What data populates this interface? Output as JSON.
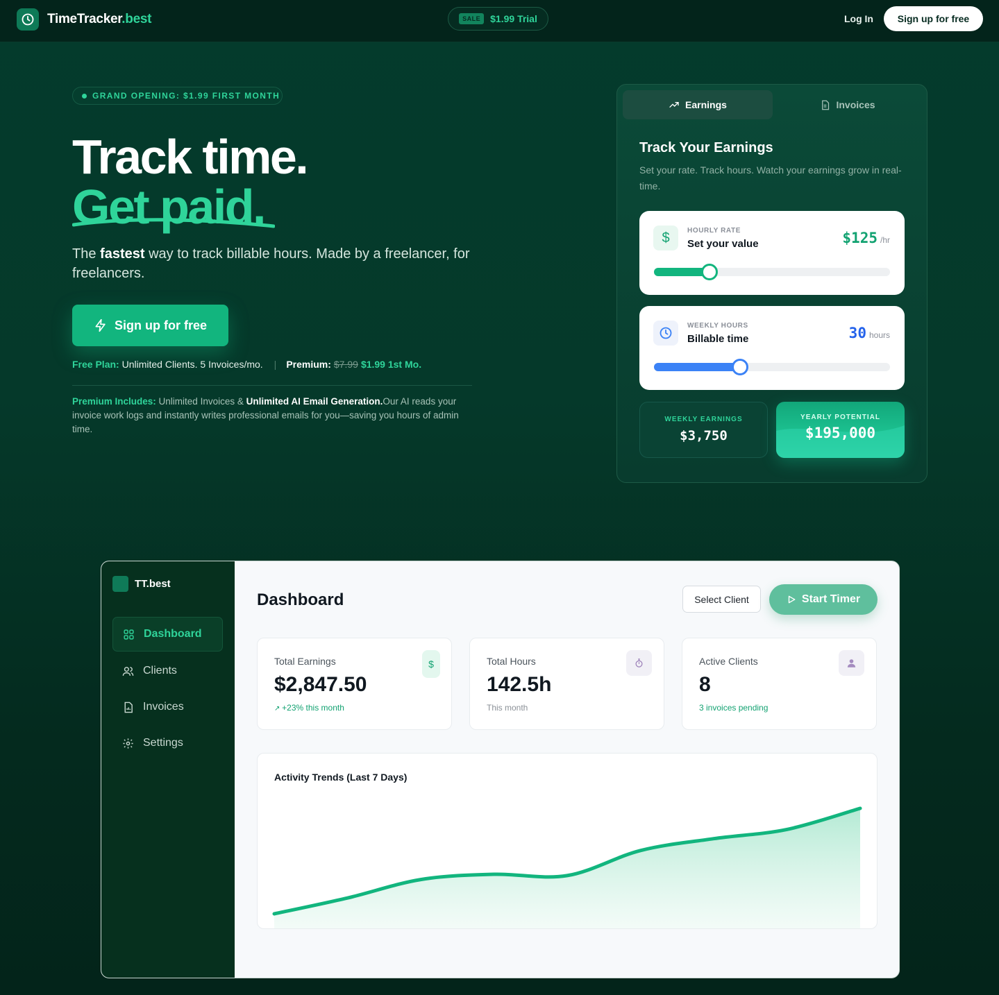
{
  "header": {
    "brand_name": "TimeTracker",
    "brand_tld": ".best",
    "sale_tag": "SALE",
    "trial_label": "$1.99 Trial",
    "login_label": "Log In",
    "signup_label": "Sign up for free"
  },
  "hero": {
    "badge": "GRAND OPENING: $1.99 FIRST MONTH",
    "headline_1": "Track time.",
    "headline_2": "Get paid.",
    "sub_pre": "The ",
    "sub_bold": "fastest",
    "sub_post": " way to track billable hours. Made by a freelancer, for freelancers.",
    "cta_label": "Sign up for free",
    "free_plan_label": "Free Plan:",
    "free_plan_text": " Unlimited Clients. 5 Invoices/mo.",
    "premium_label": "Premium:",
    "premium_old_price": "$7.99",
    "premium_new_price": "$1.99 1st Mo.",
    "includes_label": "Premium Includes:",
    "includes_text_1": " Unlimited Invoices & ",
    "includes_bold": "Unlimited AI Email Generation.",
    "includes_text_2": "Our AI reads your invoice work logs and instantly writes professional emails for you—saving you hours of admin time."
  },
  "calculator": {
    "tabs": [
      {
        "label": "Earnings",
        "icon": "trending-up-icon",
        "active": true
      },
      {
        "label": "Invoices",
        "icon": "document-icon",
        "active": false
      }
    ],
    "title": "Track Your Earnings",
    "subtitle": "Set your rate. Track hours. Watch your earnings grow in real-time.",
    "rate": {
      "label": "HOURLY RATE",
      "title": "Set your value",
      "value": "$125",
      "unit": "/hr",
      "slider_fraction": 0.235,
      "color": "#12b57e"
    },
    "hours": {
      "label": "WEEKLY HOURS",
      "title": "Billable time",
      "value": "30",
      "unit": "hours",
      "slider_fraction": 0.365,
      "color": "#3b82f6"
    },
    "weekly_label": "WEEKLY EARNINGS",
    "weekly_value": "$3,750",
    "yearly_label": "YEARLY POTENTIAL",
    "yearly_value": "$195,000"
  },
  "dashboard": {
    "brand": "TT.best",
    "nav": [
      {
        "label": "Dashboard",
        "icon": "grid-icon",
        "active": true
      },
      {
        "label": "Clients",
        "icon": "users-icon",
        "active": false
      },
      {
        "label": "Invoices",
        "icon": "invoice-icon",
        "active": false
      },
      {
        "label": "Settings",
        "icon": "gear-icon",
        "active": false
      }
    ],
    "title": "Dashboard",
    "select_client": "Select Client",
    "start_timer": "Start Timer",
    "stats": [
      {
        "label": "Total Earnings",
        "value": "$2,847.50",
        "note": "+23% this month",
        "icon": "dollar-icon"
      },
      {
        "label": "Total Hours",
        "value": "142.5h",
        "note": "This month",
        "icon": "stopwatch-icon"
      },
      {
        "label": "Active Clients",
        "value": "8",
        "note": "3 invoices pending",
        "icon": "user-icon"
      }
    ],
    "chart_title": "Activity Trends (Last 7 Days)"
  },
  "colors": {
    "accent": "#2fd49a",
    "primary": "#12b57e",
    "blue": "#3b82f6"
  },
  "chart_data": {
    "type": "area",
    "title": "Activity Trends (Last 7 Days)",
    "x": [
      1,
      2,
      3,
      4,
      5,
      6,
      7,
      8,
      9
    ],
    "series": [
      {
        "values": [
          0.1,
          0.22,
          0.36,
          0.4,
          0.39,
          0.58,
          0.67,
          0.74,
          0.9
        ]
      }
    ],
    "ylim": [
      0,
      1
    ],
    "grid": false,
    "color": "#12b57e"
  }
}
